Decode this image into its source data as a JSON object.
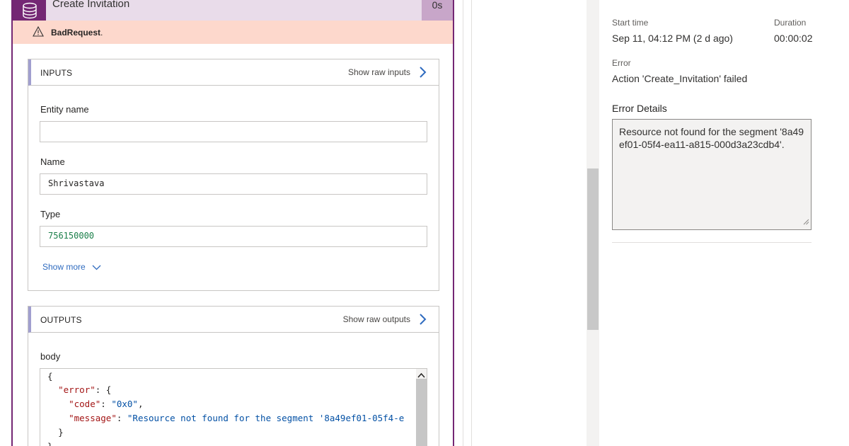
{
  "action_card": {
    "title": "Create Invitation",
    "duration": "0s",
    "error_text": "BadRequest",
    "error_suffix": "."
  },
  "inputs": {
    "header": "INPUTS",
    "show_raw_label": "Show raw inputs",
    "fields": [
      {
        "label": "Entity name",
        "value": ""
      },
      {
        "label": "Name",
        "value": "Shrivastava"
      },
      {
        "label": "Type",
        "value": "756150000"
      }
    ],
    "show_more_label": "Show more"
  },
  "outputs": {
    "header": "OUTPUTS",
    "show_raw_label": "Show raw outputs",
    "body_label": "body",
    "code": {
      "open_brace": "{",
      "error_key": "\"error\"",
      "error_open": ": {",
      "code_key": "\"code\"",
      "code_value": "\"0x0\"",
      "message_key": "\"message\"",
      "message_value": "\"Resource not found for the segment '8a49ef01-05f4-e",
      "inner_close": "}",
      "outer_close": "}"
    }
  },
  "details": {
    "start_time_label": "Start time",
    "start_time_value": "Sep 11, 04:12 PM (2 d ago)",
    "duration_label": "Duration",
    "duration_value": "00:00:02",
    "error_label": "Error",
    "error_value": "Action 'Create_Invitation' failed",
    "error_details_label": "Error Details",
    "error_details_text": "Resource not found for the segment '8a49ef01-05f4-ea11-a815-000d3a23cdb4'."
  },
  "colors": {
    "accent": "#742774",
    "error_bg": "#fdd8cc",
    "link": "#2f6bbf"
  }
}
